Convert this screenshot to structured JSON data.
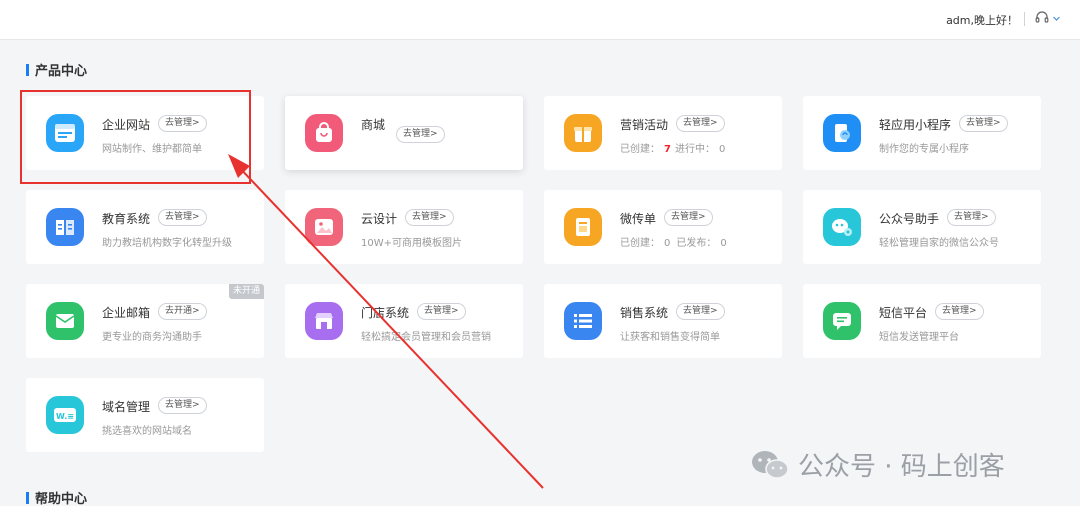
{
  "header": {
    "greeting": "adm,晚上好！"
  },
  "sections": {
    "product_center": "产品中心",
    "help_center": "帮助中心"
  },
  "cards": [
    {
      "title": "企业网站",
      "button": "去管理>",
      "desc": "网站制作、维护都简单",
      "icon": "browser-window-icon",
      "color": "#2aa6f8"
    },
    {
      "title": "商城",
      "button": "去管理>",
      "desc": "",
      "icon": "shopping-bag-icon",
      "color": "#f25a7a"
    },
    {
      "title": "营销活动",
      "button": "去管理>",
      "stats": {
        "created_label": "已创建：",
        "created_value": "7",
        "active_label": "进行中：",
        "active_value": "0"
      },
      "icon": "gift-icon",
      "color": "#f7a623"
    },
    {
      "title": "轻应用小程序",
      "button": "去管理>",
      "desc": "制作您的专属小程序",
      "icon": "mini-program-icon",
      "color": "#1f8ff5"
    },
    {
      "title": "教育系统",
      "button": "去管理>",
      "desc": "助力教培机构数字化转型升级",
      "icon": "open-book-icon",
      "color": "#3a86f0"
    },
    {
      "title": "云设计",
      "button": "去管理>",
      "desc": "10W+可商用模板图片",
      "icon": "image-icon",
      "color": "#f0657a"
    },
    {
      "title": "微传单",
      "button": "去管理>",
      "stats": {
        "created_label": "已创建：",
        "created_value": "0",
        "active_label": "已发布：",
        "active_value": "0"
      },
      "icon": "flyer-icon",
      "color": "#f7a623"
    },
    {
      "title": "公众号助手",
      "button": "去管理>",
      "desc": "轻松管理自家的微信公众号",
      "icon": "wechat-gear-icon",
      "color": "#27c6d8"
    },
    {
      "title": "企业邮箱",
      "button": "去开通>",
      "desc": "更专业的商务沟通助手",
      "icon": "envelope-icon",
      "color": "#2fc26b",
      "badge": "未开通"
    },
    {
      "title": "门店系统",
      "button": "去管理>",
      "desc": "轻松搞定会员管理和会员营销",
      "icon": "storefront-icon",
      "color": "#a86ef0"
    },
    {
      "title": "销售系统",
      "button": "去管理>",
      "desc": "让获客和销售变得简单",
      "icon": "list-icon",
      "color": "#3a86f0"
    },
    {
      "title": "短信平台",
      "button": "去管理>",
      "desc": "短信发送管理平台",
      "icon": "message-icon",
      "color": "#2fc26b"
    },
    {
      "title": "域名管理",
      "button": "去管理>",
      "desc": "挑选喜欢的网站域名",
      "icon": "domain-icon",
      "color": "#27c6d8"
    }
  ],
  "watermark": {
    "text": "公众号 · 码上创客"
  }
}
